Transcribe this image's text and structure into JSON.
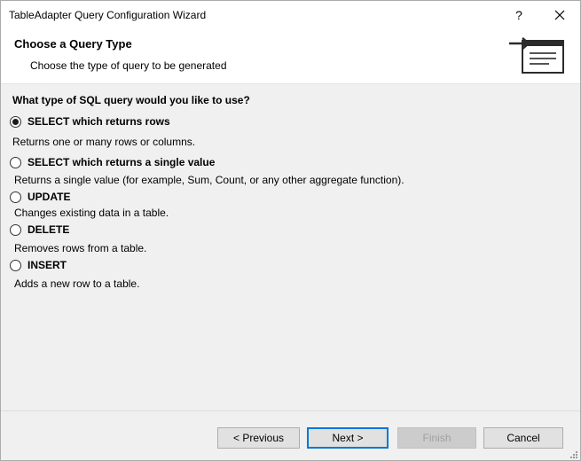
{
  "window": {
    "title": "TableAdapter Query Configuration Wizard",
    "help_glyph": "?",
    "close_icon": "close-icon"
  },
  "header": {
    "title": "Choose a Query Type",
    "subtitle": "Choose the type of query to be generated",
    "icon": "wizard-banner-icon"
  },
  "form": {
    "question": "What type of SQL query would you like to use?",
    "selected": "select_rows",
    "options": [
      {
        "id": "select_rows",
        "label": "SELECT which returns rows",
        "description": "Returns one or many rows or columns.",
        "checked": true
      },
      {
        "id": "select_single",
        "label": "SELECT which returns a single value",
        "description": "Returns a single value (for example, Sum, Count, or any other aggregate function).",
        "checked": false
      },
      {
        "id": "update",
        "label": "UPDATE",
        "description": "Changes existing data in a table.",
        "checked": false
      },
      {
        "id": "delete",
        "label": "DELETE",
        "description": "Removes rows from a table.",
        "checked": false
      },
      {
        "id": "insert",
        "label": "INSERT",
        "description": "Adds a new row to a table.",
        "checked": false
      }
    ]
  },
  "footer": {
    "previous_label": "< Previous",
    "next_label": "Next >",
    "finish_label": "Finish",
    "cancel_label": "Cancel",
    "finish_enabled": false
  },
  "colors": {
    "accent": "#0078d7",
    "window_bg": "#f0f0f0",
    "header_bg": "#ffffff"
  }
}
